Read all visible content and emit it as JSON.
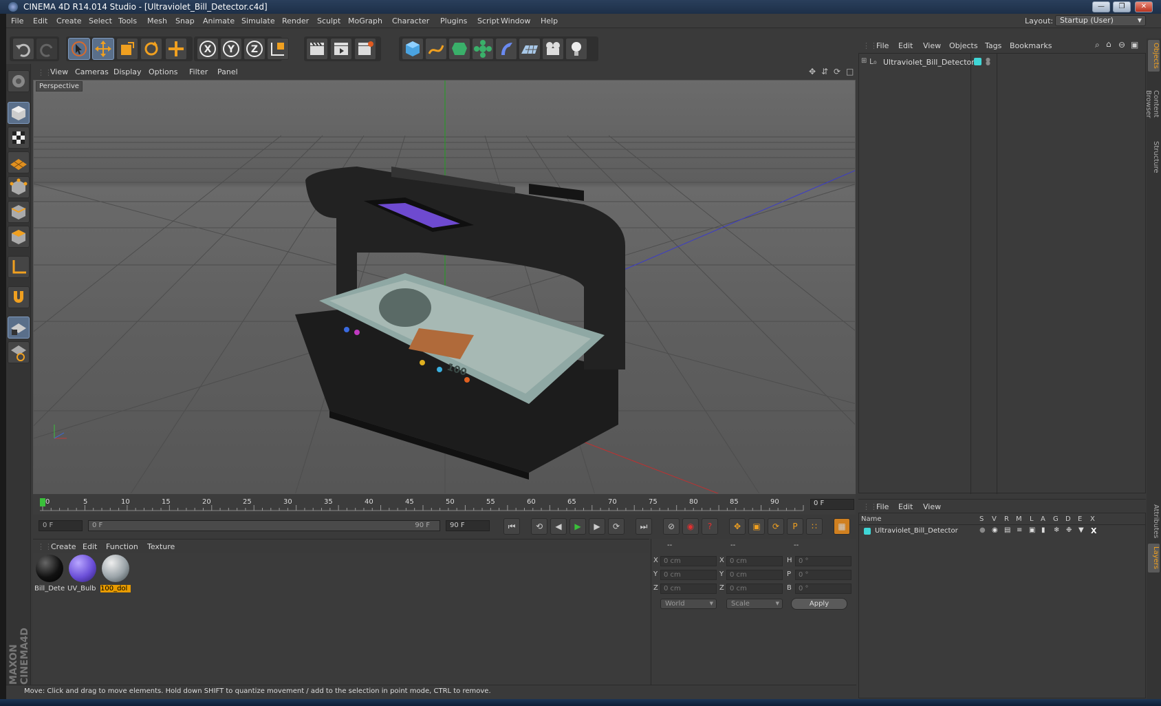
{
  "window": {
    "title": "CINEMA 4D R14.014 Studio - [Ultraviolet_Bill_Detector.c4d]"
  },
  "menubar": {
    "items": [
      "File",
      "Edit",
      "Create",
      "Select",
      "Tools",
      "Mesh",
      "Snap",
      "Animate",
      "Simulate",
      "Render",
      "Sculpt",
      "MoGraph",
      "Character",
      "Plugins",
      "Script",
      "Window",
      "Help"
    ],
    "layout_label": "Layout:",
    "layout_value": "Startup (User)"
  },
  "toolbar": {
    "axis_x": "X",
    "axis_y": "Y",
    "axis_z": "Z"
  },
  "viewport": {
    "menu": [
      "View",
      "Cameras",
      "Display",
      "Options",
      "Filter",
      "Panel"
    ],
    "camera_label": "Perspective"
  },
  "timeline": {
    "ticks": [
      "0",
      "5",
      "10",
      "15",
      "20",
      "25",
      "30",
      "35",
      "40",
      "45",
      "50",
      "55",
      "60",
      "65",
      "70",
      "75",
      "80",
      "85",
      "90"
    ],
    "current_frame": "0 F",
    "start_frame": "0 F",
    "range_start": "0 F",
    "range_end": "90 F",
    "end_frame": "90 F"
  },
  "materials": {
    "menu": [
      "Create",
      "Edit",
      "Function",
      "Texture"
    ],
    "items": [
      {
        "label": "Bill_Dete",
        "color": "#111111"
      },
      {
        "label": "UV_Bulb",
        "color": "#6b4fd8"
      },
      {
        "label": "100_dol",
        "color": "#9aa3a8"
      }
    ]
  },
  "coordinates": {
    "headers": [
      "--",
      "--",
      "--"
    ],
    "rows": [
      {
        "pos_label": "X",
        "pos_value": "0 cm",
        "size_label": "X",
        "size_value": "0 cm",
        "rot_label": "H",
        "rot_value": "0 °"
      },
      {
        "pos_label": "Y",
        "pos_value": "0 cm",
        "size_label": "Y",
        "size_value": "0 cm",
        "rot_label": "P",
        "rot_value": "0 °"
      },
      {
        "pos_label": "Z",
        "pos_value": "0 cm",
        "size_label": "Z",
        "size_value": "0 cm",
        "rot_label": "B",
        "rot_value": "0 °"
      }
    ],
    "space_select": "World",
    "mode_select": "Scale",
    "apply_label": "Apply"
  },
  "object_manager": {
    "menu": [
      "File",
      "Edit",
      "View",
      "Objects",
      "Tags",
      "Bookmarks"
    ],
    "object_name": "Ultraviolet_Bill_Detector",
    "object_color": "#3fd6d6"
  },
  "layer_manager": {
    "menu": [
      "File",
      "Edit",
      "View"
    ],
    "columns": [
      "Name",
      "S",
      "V",
      "R",
      "M",
      "L",
      "A",
      "G",
      "D",
      "E",
      "X"
    ],
    "layer_name": "Ultraviolet_Bill_Detector"
  },
  "side_tabs": [
    "Objects",
    "Content Browser",
    "Structure"
  ],
  "side_tabs_lower": [
    "Attributes",
    "Layers"
  ],
  "statusbar": {
    "text": "Move: Click and drag to move elements. Hold down SHIFT to quantize movement / add to the selection in point mode, CTRL to remove."
  },
  "branding": {
    "logo_text": "MAXON CINEMA4D"
  }
}
